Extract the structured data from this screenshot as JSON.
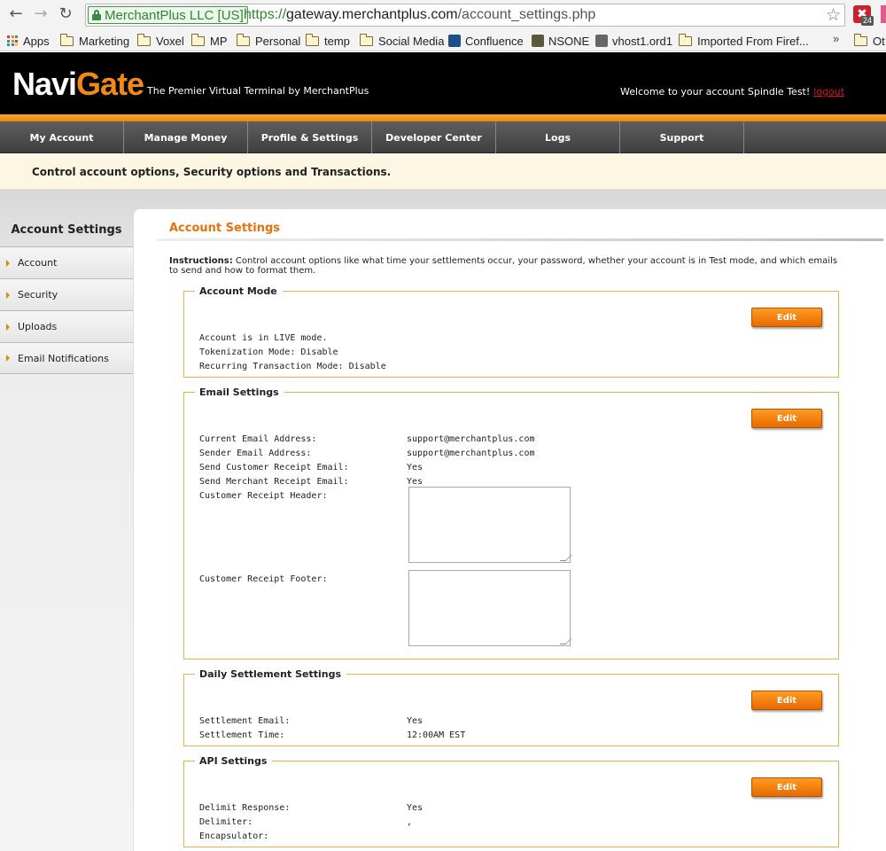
{
  "browser": {
    "ev_label": "MerchantPlus LLC [US]",
    "url_scheme": "https://",
    "url_host": "gateway.merchantplus.com",
    "url_path": "/account_settings.php",
    "extension_count": "24",
    "more": "»"
  },
  "bookmarks": [
    "Apps",
    "Marketing",
    "Voxel",
    "MP",
    "Personal",
    "temp",
    "Social Media",
    "Confluence",
    "NSONE",
    "vhost1.ord1",
    "Imported From Firef...",
    "Ot"
  ],
  "header": {
    "logo_left": "Navi",
    "logo_right": "Gate",
    "tagline": "The Premier Virtual Terminal by MerchantPlus",
    "welcome": "Welcome to your account Spindle Test!",
    "logout": "logout"
  },
  "nav": [
    "My Account",
    "Manage Money",
    "Profile & Settings",
    "Developer Center",
    "Logs",
    "Support"
  ],
  "description": "Control account options, Security options and Transactions.",
  "sidebar": {
    "title": "Account Settings",
    "items": [
      "Account",
      "Security",
      "Uploads",
      "Email Notifications"
    ]
  },
  "content": {
    "title": "Account Settings",
    "instructions_label": "Instructions:",
    "instructions_text": " Control account options like what time your settlements occur, your password, whether your account is in Test mode, and which emails to send and how to format them.",
    "edit_label": "Edit",
    "account_mode": {
      "legend": "Account Mode",
      "lines": [
        "Account is in LIVE mode.",
        "Tokenization Mode: Disable",
        "Recurring Transaction Mode: Disable"
      ]
    },
    "email_settings": {
      "legend": "Email Settings",
      "rows": [
        {
          "label": "Current Email Address:",
          "value": "support@merchantplus.com"
        },
        {
          "label": "Sender Email Address:",
          "value": "support@merchantplus.com"
        },
        {
          "label": "Send Customer Receipt Email:",
          "value": "Yes"
        },
        {
          "label": "Send Merchant Receipt Email:",
          "value": "Yes"
        }
      ],
      "header_label": "Customer Receipt Header:",
      "footer_label": "Customer Receipt Footer:"
    },
    "daily_settlement": {
      "legend": "Daily Settlement Settings",
      "rows": [
        {
          "label": "Settlement Email:",
          "value": "Yes"
        },
        {
          "label": "Settlement Time:",
          "value": "12:00AM EST"
        }
      ]
    },
    "api_settings": {
      "legend": "API Settings",
      "rows": [
        {
          "label": "Delimit Response:",
          "value": "Yes"
        },
        {
          "label": "Delimiter:",
          "value": ","
        },
        {
          "label": "Encapsulator:",
          "value": ""
        }
      ]
    }
  }
}
